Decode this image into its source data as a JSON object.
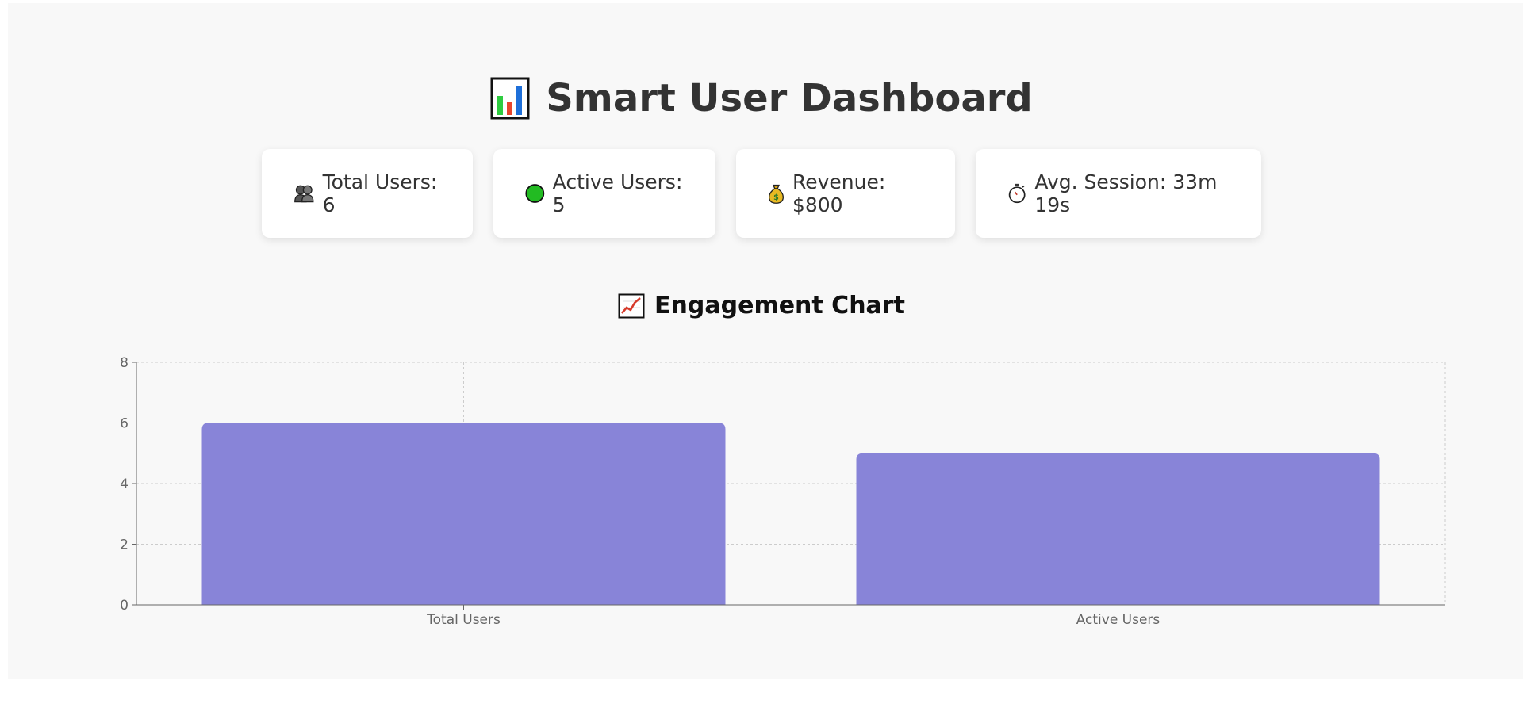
{
  "header": {
    "title": "Smart User Dashboard",
    "icon": "bar-chart-icon"
  },
  "stats": [
    {
      "icon": "users-icon",
      "label": "Total Users: 6"
    },
    {
      "icon": "green-circle-icon",
      "label": "Active Users: 5"
    },
    {
      "icon": "money-bag-icon",
      "label": "Revenue: $800"
    },
    {
      "icon": "stopwatch-icon",
      "label": "Avg. Session: 33m 19s"
    }
  ],
  "chart_section": {
    "title": "Engagement Chart",
    "icon": "trending-up-icon"
  },
  "colors": {
    "bar": "#8884d8",
    "panel_bg": "#f8f8f8",
    "grid": "#cccccc",
    "axis": "#666666"
  },
  "chart_data": {
    "type": "bar",
    "categories": [
      "Total Users",
      "Active Users"
    ],
    "values": [
      6,
      5
    ],
    "ylim": [
      0,
      8
    ],
    "yticks": [
      0,
      2,
      4,
      6,
      8
    ],
    "grid": true,
    "title": "",
    "xlabel": "",
    "ylabel": ""
  }
}
